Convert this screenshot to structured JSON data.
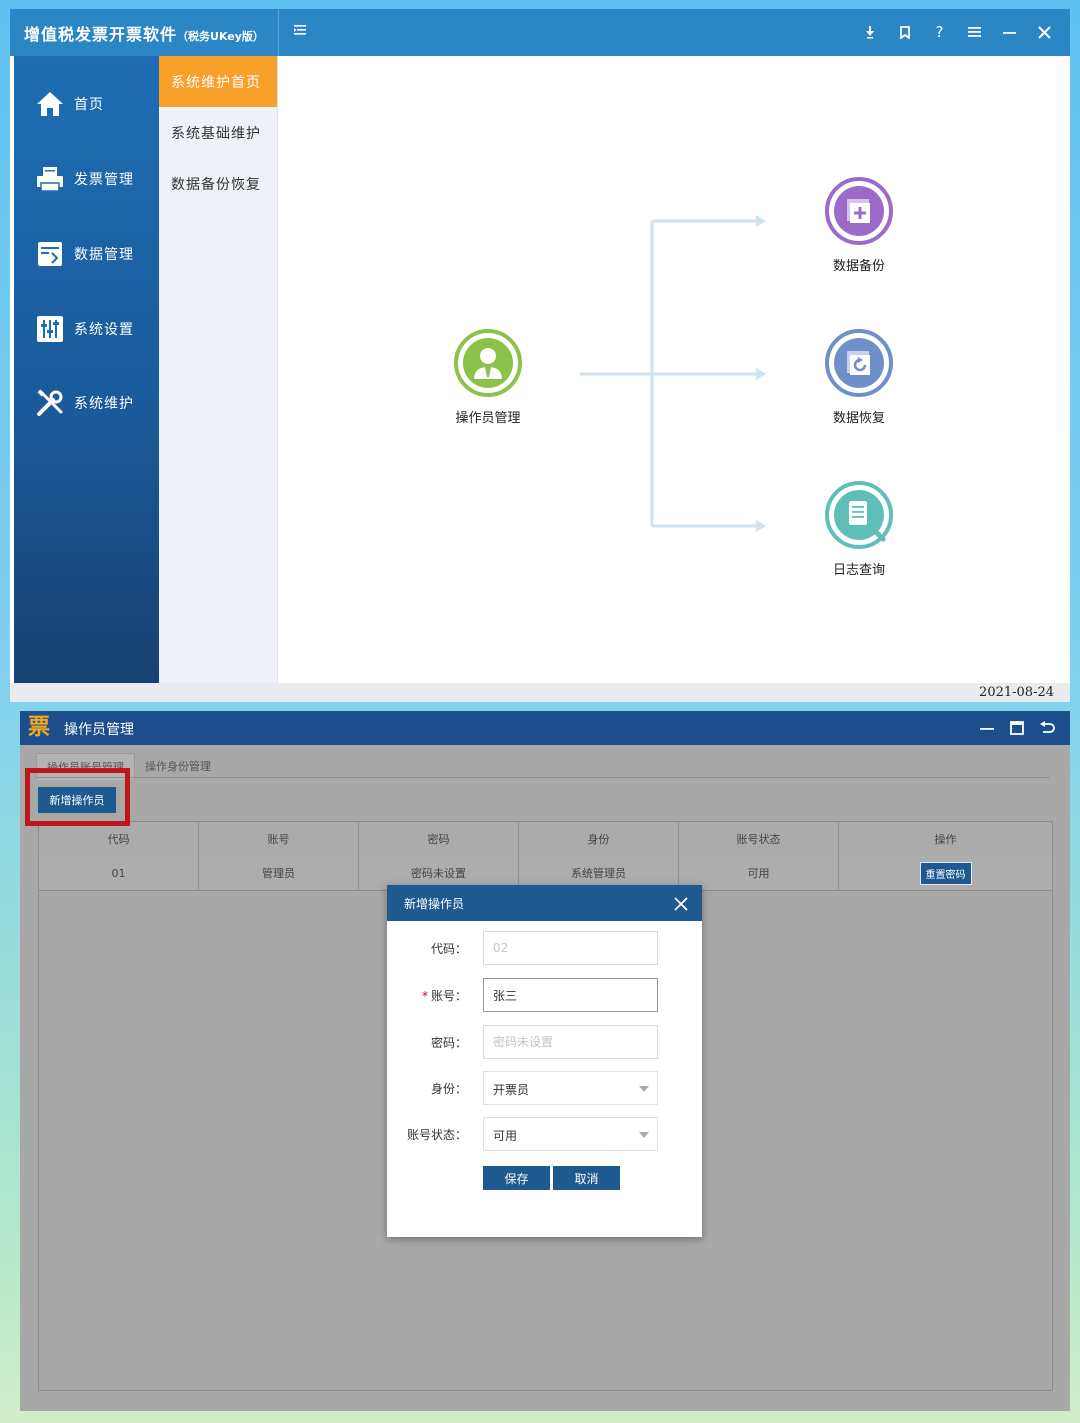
{
  "app": {
    "title": "增值税发票开票软件",
    "subtitle": "（税务UKey版）",
    "toolbar_icons": [
      "download-icon",
      "bookmark-icon",
      "help-icon",
      "menu-icon",
      "minimize-icon",
      "close-icon"
    ],
    "collapse_icon": "collapse-menu-icon"
  },
  "sidebar": {
    "items": [
      {
        "label": "首页",
        "icon": "home-icon"
      },
      {
        "label": "发票管理",
        "icon": "printer-icon"
      },
      {
        "label": "数据管理",
        "icon": "data-icon"
      },
      {
        "label": "系统设置",
        "icon": "sliders-icon"
      },
      {
        "label": "系统维护",
        "icon": "tools-icon"
      }
    ]
  },
  "subnav": {
    "items": [
      {
        "label": "系统维护首页",
        "active": true
      },
      {
        "label": "系统基础维护",
        "active": false
      },
      {
        "label": "数据备份恢复",
        "active": false
      }
    ]
  },
  "flow": {
    "source": {
      "label": "操作员管理",
      "icon": "operator-icon",
      "color": "#8bc34a"
    },
    "targets": [
      {
        "label": "数据备份",
        "icon": "backup-icon",
        "color": "#9c6ac8"
      },
      {
        "label": "数据恢复",
        "icon": "restore-icon",
        "color": "#6f8fc8"
      },
      {
        "label": "日志查询",
        "icon": "log-search-icon",
        "color": "#5fbfb8"
      }
    ]
  },
  "status": {
    "date": "2021-08-24"
  },
  "operator_window": {
    "logo": "票",
    "title": "操作员管理",
    "tabs": [
      {
        "label": "操作员账号管理",
        "active": true
      },
      {
        "label": "操作身份管理",
        "active": false
      }
    ],
    "add_button": "新增操作员",
    "table": {
      "columns": [
        "代码",
        "账号",
        "密码",
        "身份",
        "账号状态",
        "操作"
      ],
      "rows": [
        {
          "code": "01",
          "account": "管理员",
          "password": "密码未设置",
          "role": "系统管理员",
          "status": "可用",
          "action": "重置密码"
        }
      ]
    }
  },
  "dialog": {
    "title": "新增操作员",
    "fields": {
      "code": {
        "label": "代码：",
        "placeholder": "02"
      },
      "account": {
        "label": "账号：",
        "value": "张三",
        "required": true
      },
      "password": {
        "label": "密码：",
        "placeholder": "密码未设置"
      },
      "role": {
        "label": "身份：",
        "value": "开票员"
      },
      "status": {
        "label": "账号状态：",
        "value": "可用"
      }
    },
    "save": "保存",
    "cancel": "取消"
  },
  "colors": {
    "title_bar": "#2b86c6",
    "sidebar": "#1a5a9a",
    "active_subnav": "#f7a02a",
    "dialog_header": "#1e5a8f",
    "highlight": "#c0151b"
  }
}
